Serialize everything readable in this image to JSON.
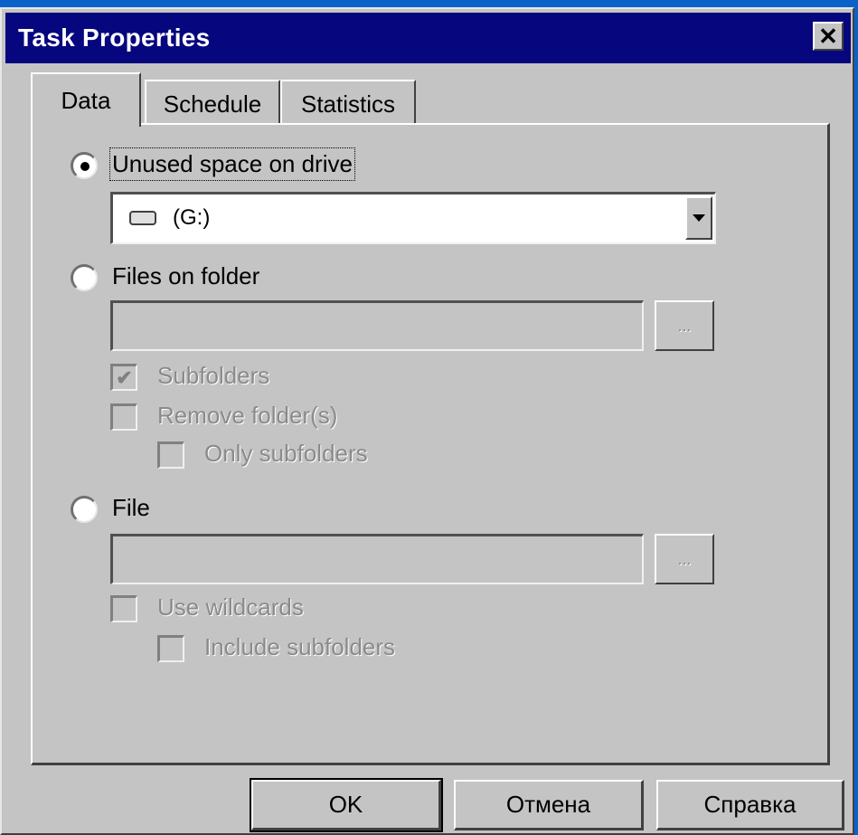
{
  "window": {
    "title": "Task Properties",
    "close_symbol": "✕"
  },
  "tabs": [
    {
      "label": "Data",
      "active": true
    },
    {
      "label": "Schedule",
      "active": false
    },
    {
      "label": "Statistics",
      "active": false
    }
  ],
  "data_tab": {
    "unused_space": {
      "label": "Unused space on drive",
      "selected": true,
      "drive_select": {
        "value": "(G:)",
        "icon": "drive-icon"
      }
    },
    "files_on_folder": {
      "label": "Files on folder",
      "selected": false,
      "path_value": "",
      "browse_label": "...",
      "subfolders_label": "Subfolders",
      "subfolders_checked": true,
      "remove_folders_label": "Remove folder(s)",
      "remove_folders_checked": false,
      "only_subfolders_label": "Only subfolders",
      "only_subfolders_checked": false
    },
    "file": {
      "label": "File",
      "selected": false,
      "path_value": "",
      "browse_label": "...",
      "use_wildcards_label": "Use wildcards",
      "use_wildcards_checked": false,
      "include_subfolders_label": "Include subfolders",
      "include_subfolders_checked": false
    }
  },
  "buttons": {
    "ok": "OK",
    "cancel": "Отмена",
    "help": "Справка"
  }
}
